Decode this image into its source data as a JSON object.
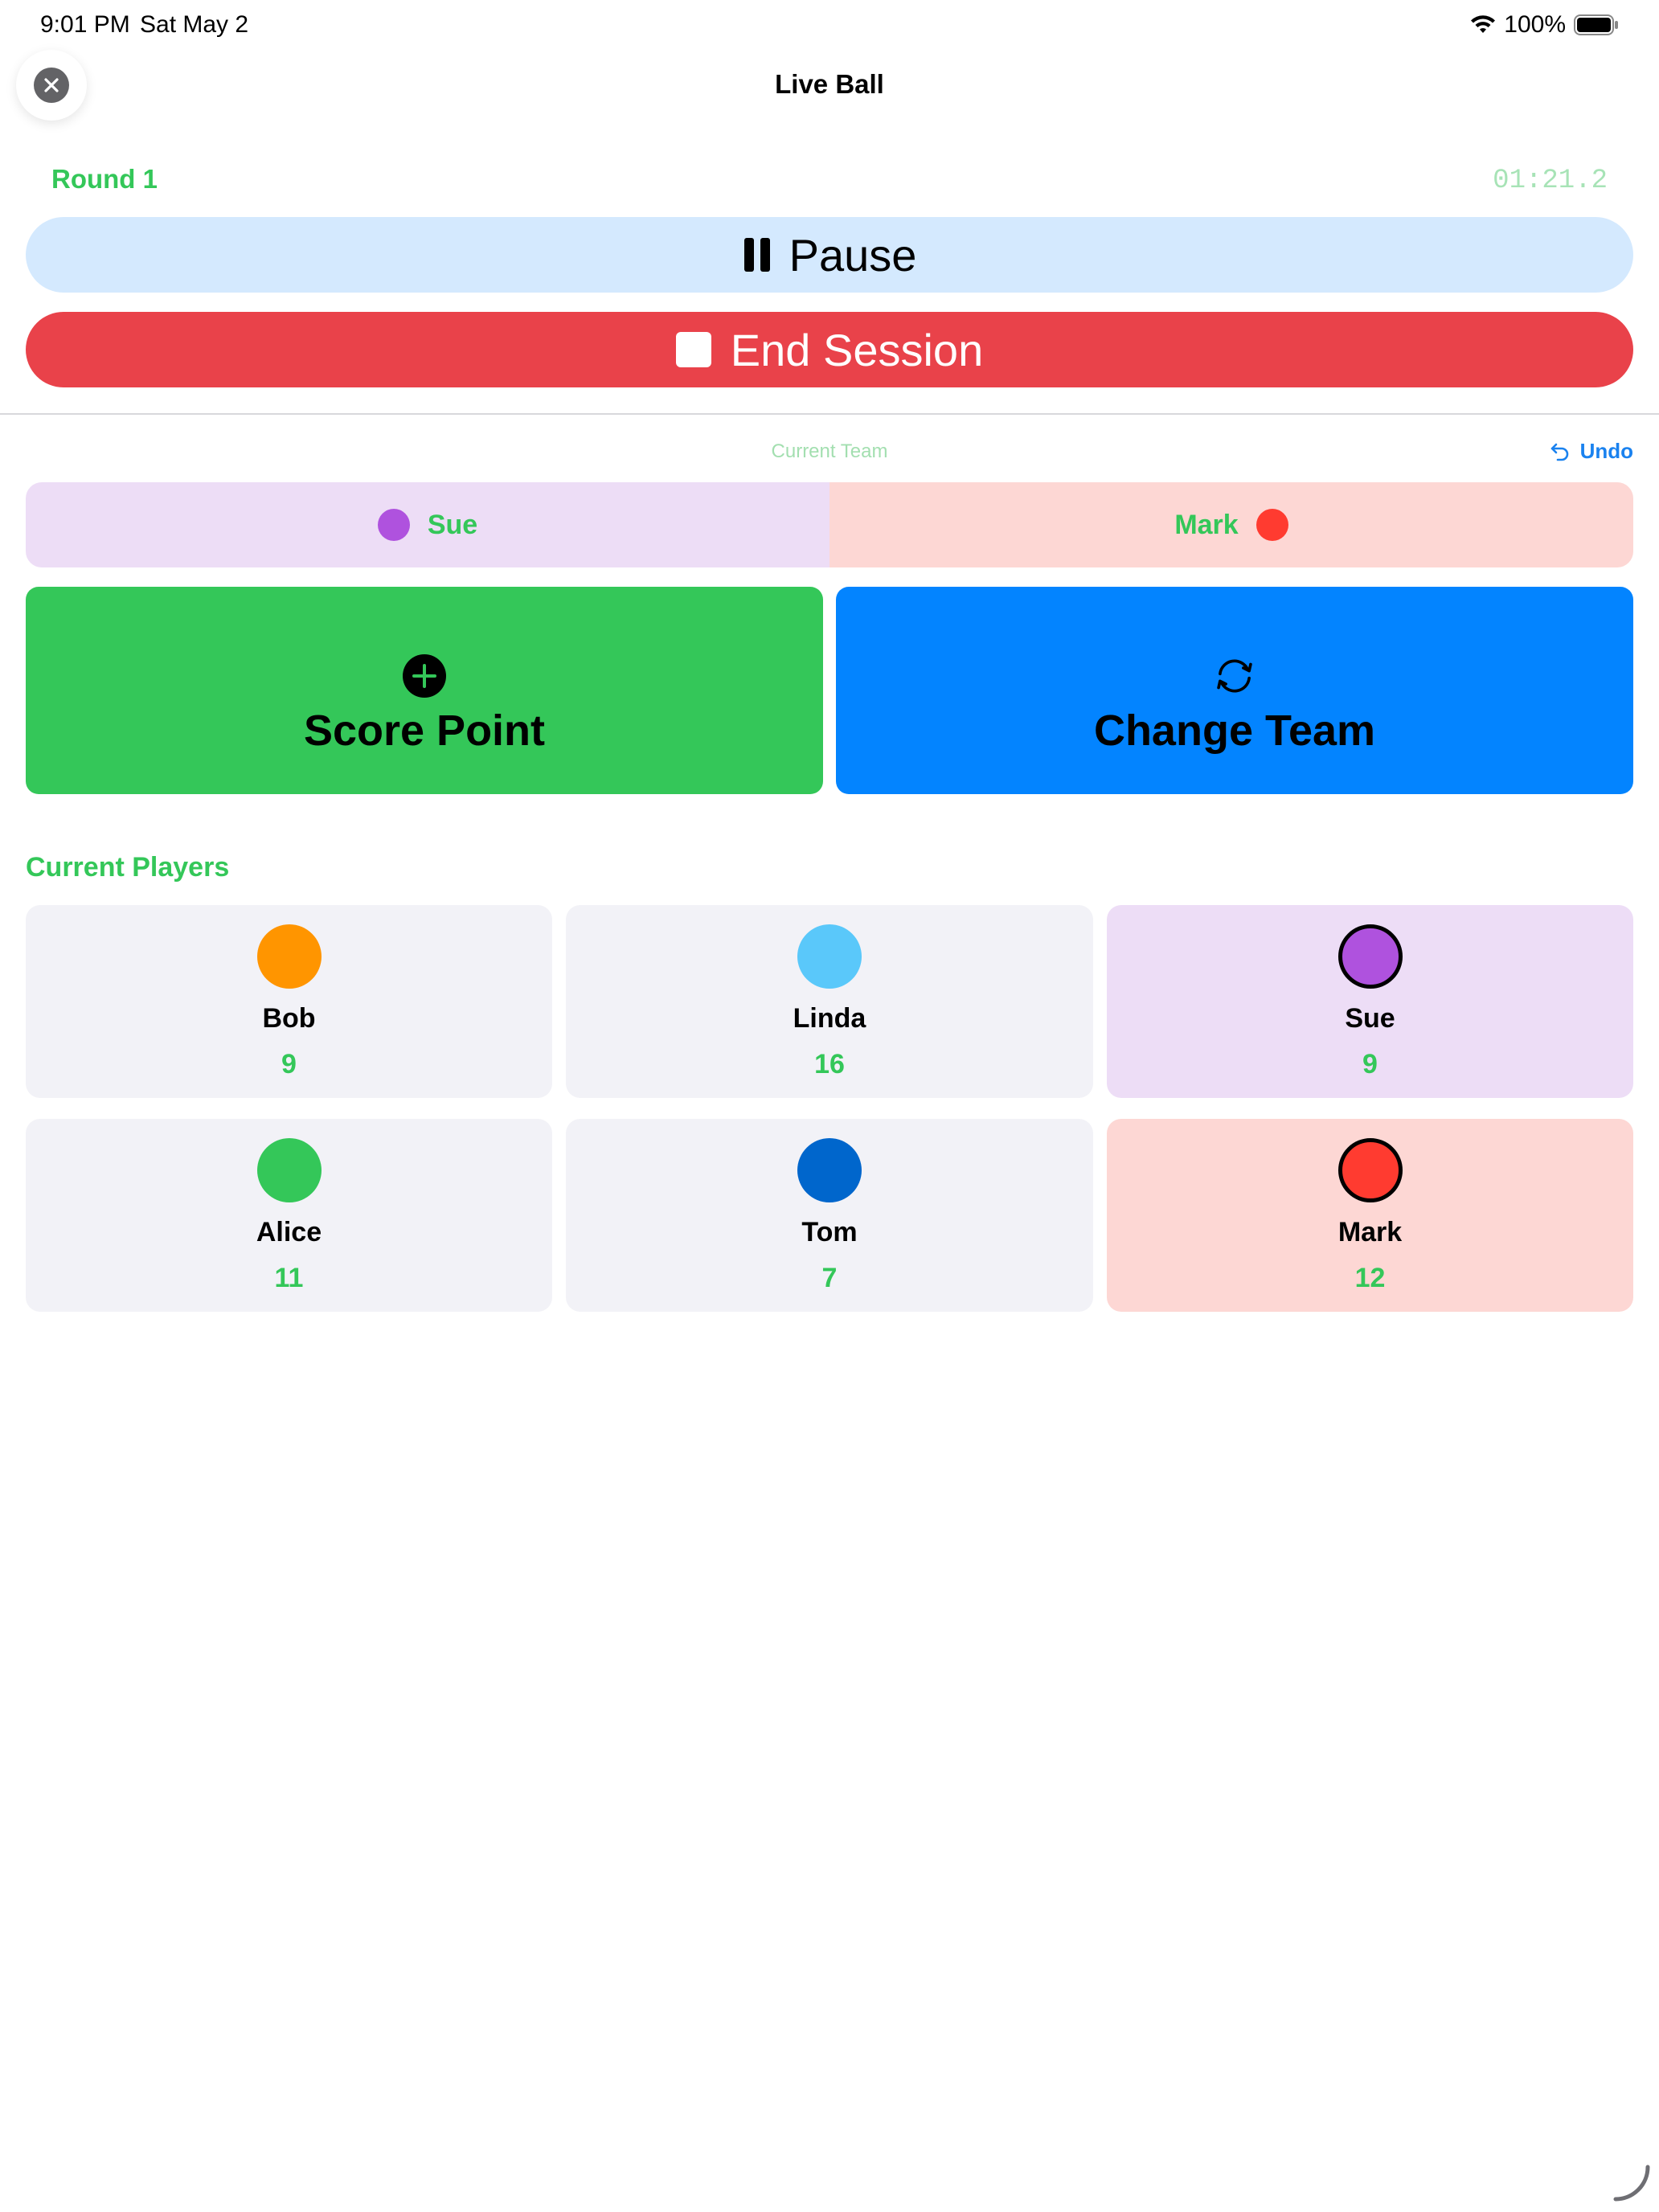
{
  "status_bar": {
    "time": "9:01 PM",
    "date": "Sat May 2",
    "battery": "100%"
  },
  "nav": {
    "title": "Live Ball",
    "close_icon": "xmark-circle-icon"
  },
  "round": {
    "label": "Round 1",
    "timer": "01:21.2"
  },
  "controls": {
    "pause_label": "Pause",
    "end_label": "End Session"
  },
  "current_team": {
    "label": "Current Team",
    "undo_label": "Undo",
    "left_player": "Sue",
    "right_player": "Mark",
    "left_color": "#AF52DE",
    "right_color": "#FF3B30"
  },
  "actions": {
    "score_label": "Score Point",
    "change_label": "Change Team"
  },
  "players": {
    "title": "Current Players",
    "items": [
      {
        "name": "Bob",
        "score": "9",
        "color": "#FF9500",
        "selected": false,
        "bg": "#F2F2F7"
      },
      {
        "name": "Linda",
        "score": "16",
        "color": "#5AC8FA",
        "selected": false,
        "bg": "#F2F2F7"
      },
      {
        "name": "Sue",
        "score": "9",
        "color": "#AF52DE",
        "selected": true,
        "bg": "#EDDDF6"
      },
      {
        "name": "Alice",
        "score": "11",
        "color": "#34C759",
        "selected": false,
        "bg": "#F2F2F7"
      },
      {
        "name": "Tom",
        "score": "7",
        "color": "#0066CC",
        "selected": false,
        "bg": "#F2F2F7"
      },
      {
        "name": "Mark",
        "score": "12",
        "color": "#FF3B30",
        "selected": true,
        "bg": "#FDD7D4"
      }
    ]
  },
  "colors": {
    "accent_green": "#34C759",
    "accent_blue": "#0384FF",
    "danger_red": "#E9424A",
    "pause_bg": "#D4E9FE"
  }
}
